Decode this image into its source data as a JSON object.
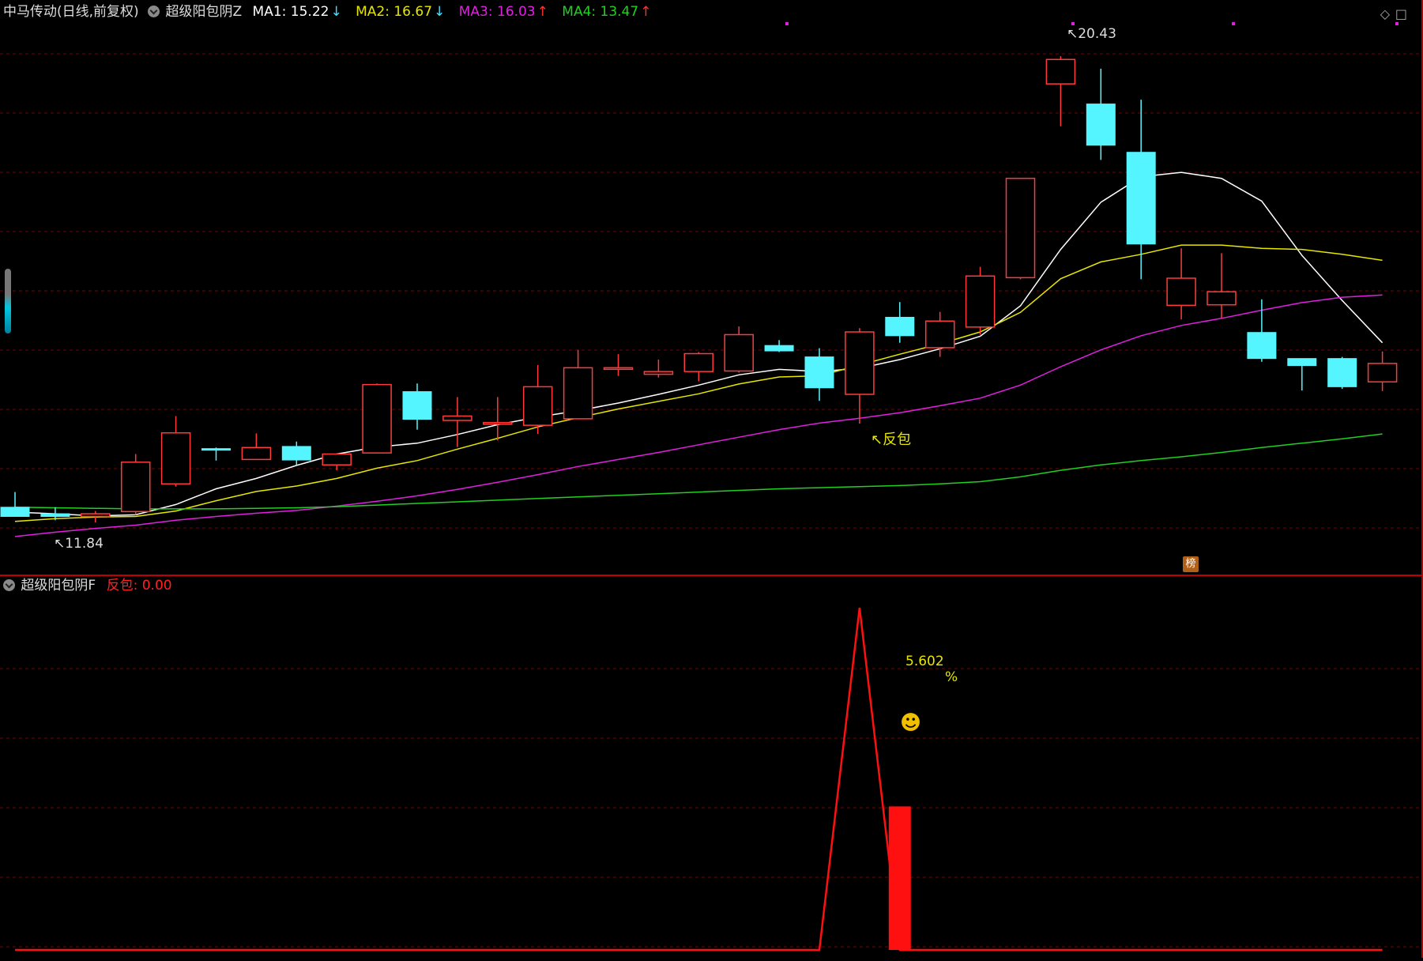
{
  "header": {
    "stock_title": "中马传动(日线,前复权)",
    "indicator_name": "超级阳包阴Z",
    "ma1_label": "MA1: 15.22",
    "ma2_label": "MA2: 16.67",
    "ma3_label": "MA3: 16.03",
    "ma4_label": "MA4: 13.47",
    "ma1_arrow": "↓",
    "ma2_arrow": "↓",
    "ma3_arrow": "↑",
    "ma4_arrow": "↑"
  },
  "sub_header": {
    "indicator_name": "超级阳包阴F",
    "signal_label": "反包: 0.00"
  },
  "colors": {
    "up": "#ff3b3b",
    "down": "#55f5ff",
    "ma1": "#ffffff",
    "ma2": "#e6e600",
    "ma3": "#e020e0",
    "ma4": "#20d020",
    "grid": "#7a0000",
    "divider": "#c00000",
    "signal": "#ff1010",
    "text_yellow": "#e6e600"
  },
  "annotations": {
    "high_label": "20.43",
    "low_label": "11.84",
    "fanbao_label": "反包",
    "pct_value": "5.602",
    "pct_sign": "%",
    "smile": "☻",
    "badge": "榜"
  },
  "icons": [
    "chevron-down-icon",
    "diamond-icon",
    "square-icon",
    "smile-icon"
  ],
  "chart_data": {
    "type": "candlestick",
    "price_axis": {
      "ylim": [
        11.2,
        21.0
      ]
    },
    "candles": [
      {
        "o": 12.12,
        "h": 12.4,
        "l": 11.95,
        "c": 11.95
      },
      {
        "o": 12.0,
        "h": 12.12,
        "l": 11.88,
        "c": 11.95
      },
      {
        "o": 11.95,
        "h": 12.05,
        "l": 11.84,
        "c": 12.0
      },
      {
        "o": 12.04,
        "h": 13.1,
        "l": 11.98,
        "c": 12.95
      },
      {
        "o": 12.55,
        "h": 13.8,
        "l": 12.5,
        "c": 13.49
      },
      {
        "o": 13.2,
        "h": 13.22,
        "l": 12.98,
        "c": 13.18
      },
      {
        "o": 13.0,
        "h": 13.48,
        "l": 13.0,
        "c": 13.22
      },
      {
        "o": 13.24,
        "h": 13.33,
        "l": 12.9,
        "c": 12.99
      },
      {
        "o": 12.9,
        "h": 13.1,
        "l": 12.8,
        "c": 13.1
      },
      {
        "o": 13.12,
        "h": 14.4,
        "l": 13.12,
        "c": 14.38
      },
      {
        "o": 14.25,
        "h": 14.4,
        "l": 13.55,
        "c": 13.74
      },
      {
        "o": 13.72,
        "h": 14.15,
        "l": 13.23,
        "c": 13.8
      },
      {
        "o": 13.65,
        "h": 14.15,
        "l": 13.35,
        "c": 13.68
      },
      {
        "o": 13.63,
        "h": 14.74,
        "l": 13.47,
        "c": 14.34
      },
      {
        "o": 13.75,
        "h": 15.02,
        "l": 13.75,
        "c": 14.69
      },
      {
        "o": 14.69,
        "h": 14.94,
        "l": 14.54,
        "c": 14.69
      },
      {
        "o": 14.57,
        "h": 14.84,
        "l": 14.51,
        "c": 14.62
      },
      {
        "o": 14.62,
        "h": 14.98,
        "l": 14.44,
        "c": 14.95
      },
      {
        "o": 14.63,
        "h": 15.45,
        "l": 14.6,
        "c": 15.3
      },
      {
        "o": 15.1,
        "h": 15.2,
        "l": 14.98,
        "c": 15.0
      },
      {
        "o": 14.89,
        "h": 15.05,
        "l": 14.08,
        "c": 14.32
      },
      {
        "o": 14.2,
        "h": 15.42,
        "l": 13.66,
        "c": 15.35
      },
      {
        "o": 15.62,
        "h": 15.9,
        "l": 15.15,
        "c": 15.28
      },
      {
        "o": 15.06,
        "h": 15.72,
        "l": 14.89,
        "c": 15.55
      },
      {
        "o": 15.44,
        "h": 16.55,
        "l": 15.3,
        "c": 16.38
      },
      {
        "o": 16.35,
        "h": 18.18,
        "l": 16.32,
        "c": 18.18
      },
      {
        "o": 19.92,
        "h": 20.43,
        "l": 19.14,
        "c": 20.37
      },
      {
        "o": 19.55,
        "h": 20.2,
        "l": 18.52,
        "c": 18.79
      },
      {
        "o": 18.66,
        "h": 19.63,
        "l": 16.32,
        "c": 16.97
      },
      {
        "o": 15.84,
        "h": 16.89,
        "l": 15.58,
        "c": 16.34
      },
      {
        "o": 15.85,
        "h": 16.8,
        "l": 15.6,
        "c": 16.09
      },
      {
        "o": 15.34,
        "h": 15.95,
        "l": 14.8,
        "c": 14.86
      },
      {
        "o": 14.86,
        "h": 14.86,
        "l": 14.27,
        "c": 14.73
      },
      {
        "o": 14.86,
        "h": 14.89,
        "l": 14.3,
        "c": 14.34
      },
      {
        "o": 14.43,
        "h": 14.99,
        "l": 14.26,
        "c": 14.77
      }
    ],
    "series": [
      {
        "name": "MA1",
        "values": [
          12.03,
          12.0,
          11.96,
          11.98,
          12.17,
          12.46,
          12.65,
          12.89,
          13.1,
          13.23,
          13.3,
          13.46,
          13.64,
          13.78,
          13.9,
          14.04,
          14.2,
          14.37,
          14.56,
          14.66,
          14.62,
          14.68,
          14.84,
          15.04,
          15.27,
          15.83,
          16.87,
          17.74,
          18.21,
          18.29,
          18.18,
          17.76,
          16.76,
          15.93,
          15.15
        ]
      },
      {
        "name": "MA2",
        "values": [
          11.86,
          11.91,
          11.94,
          11.95,
          12.05,
          12.24,
          12.41,
          12.51,
          12.65,
          12.84,
          12.98,
          13.19,
          13.39,
          13.6,
          13.77,
          13.93,
          14.07,
          14.21,
          14.39,
          14.52,
          14.54,
          14.74,
          14.94,
          15.13,
          15.35,
          15.71,
          16.33,
          16.64,
          16.78,
          16.95,
          16.95,
          16.89,
          16.87,
          16.78,
          16.67
        ]
      },
      {
        "name": "MA3",
        "values": [
          11.58,
          11.66,
          11.73,
          11.79,
          11.88,
          11.95,
          12.01,
          12.06,
          12.14,
          12.23,
          12.33,
          12.45,
          12.58,
          12.72,
          12.87,
          13.0,
          13.13,
          13.27,
          13.41,
          13.55,
          13.67,
          13.76,
          13.86,
          13.99,
          14.13,
          14.37,
          14.71,
          15.02,
          15.28,
          15.47,
          15.6,
          15.75,
          15.89,
          15.99,
          16.03
        ]
      },
      {
        "name": "MA4",
        "values": [
          12.12,
          12.11,
          12.1,
          12.09,
          12.09,
          12.09,
          12.1,
          12.11,
          12.13,
          12.16,
          12.19,
          12.22,
          12.25,
          12.28,
          12.31,
          12.34,
          12.37,
          12.4,
          12.43,
          12.46,
          12.48,
          12.5,
          12.52,
          12.55,
          12.59,
          12.68,
          12.8,
          12.9,
          12.98,
          13.05,
          13.13,
          13.22,
          13.3,
          13.38,
          13.47
        ]
      }
    ],
    "sub_chart": {
      "ylim": [
        0,
        6.4
      ],
      "signal_line": [
        0,
        0,
        0,
        0,
        0,
        0,
        0,
        0,
        0,
        0,
        0,
        0,
        0,
        0,
        0,
        0,
        0,
        0,
        0,
        0,
        0,
        6.2,
        0,
        0,
        0,
        0,
        0,
        0,
        0,
        0,
        0,
        0,
        0,
        0,
        0
      ],
      "bar_index": 22,
      "bar_value": 2.6
    }
  }
}
